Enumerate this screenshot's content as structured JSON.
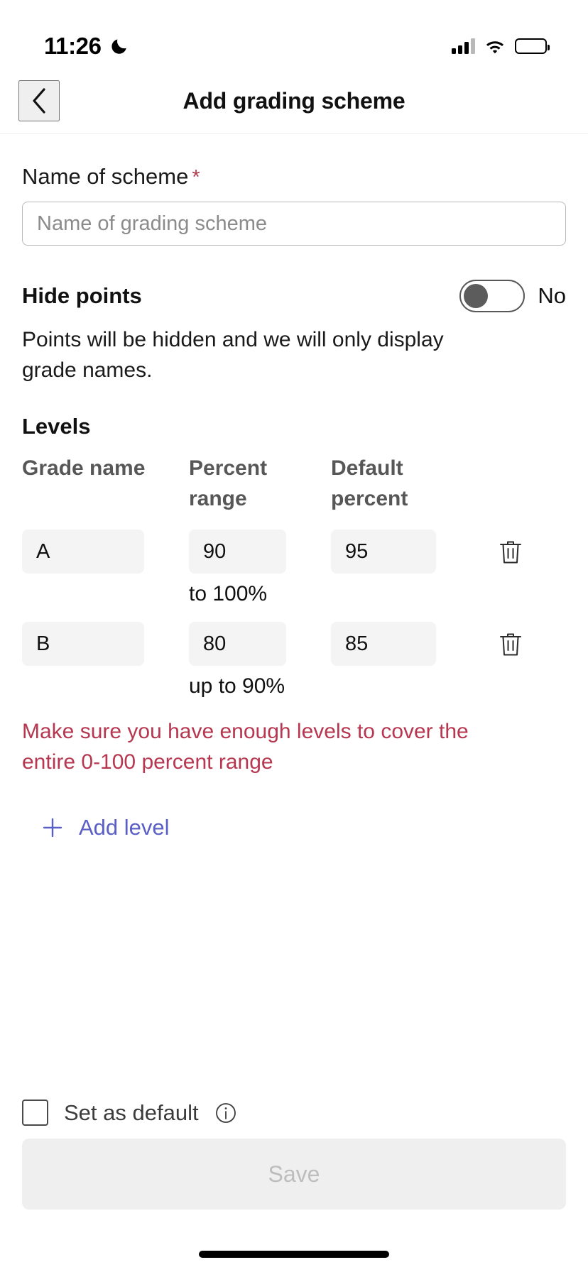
{
  "status_bar": {
    "time": "11:26",
    "dnd_icon": "moon-icon",
    "cellular_icon": "cellular-bars-icon",
    "wifi_icon": "wifi-icon",
    "battery_icon": "battery-icon"
  },
  "nav": {
    "back_icon": "chevron-left-icon",
    "title": "Add grading scheme"
  },
  "form": {
    "name_label": "Name of scheme",
    "required_marker": "*",
    "name_value": "",
    "name_placeholder": "Name of grading scheme",
    "hide_points_label": "Hide points",
    "hide_points_value": "No",
    "hide_points_on": false,
    "hide_points_help": "Points will be hidden and we will only display grade names."
  },
  "levels": {
    "section_title": "Levels",
    "columns": [
      "Grade name",
      "Percent range",
      "Default percent"
    ],
    "delete_icon": "trash-icon",
    "rows": [
      {
        "grade_name": "A",
        "percent_from": "90",
        "range_note": "to 100%",
        "default_percent": "95"
      },
      {
        "grade_name": "B",
        "percent_from": "80",
        "range_note": "up to 90%",
        "default_percent": "85"
      }
    ],
    "error": "Make sure you have enough levels to cover the entire 0-100 percent range",
    "add_level_label": "Add level",
    "add_level_icon": "plus-icon"
  },
  "footer": {
    "set_default_label": "Set as default",
    "set_default_checked": false,
    "info_icon": "info-circle-icon",
    "save_label": "Save",
    "save_disabled": true
  },
  "colors": {
    "error_red": "#b6374f",
    "link_indigo": "#5a5fc7",
    "input_fill": "#f4f4f4",
    "save_bg": "#efefef",
    "save_text": "#bdbdbd"
  }
}
